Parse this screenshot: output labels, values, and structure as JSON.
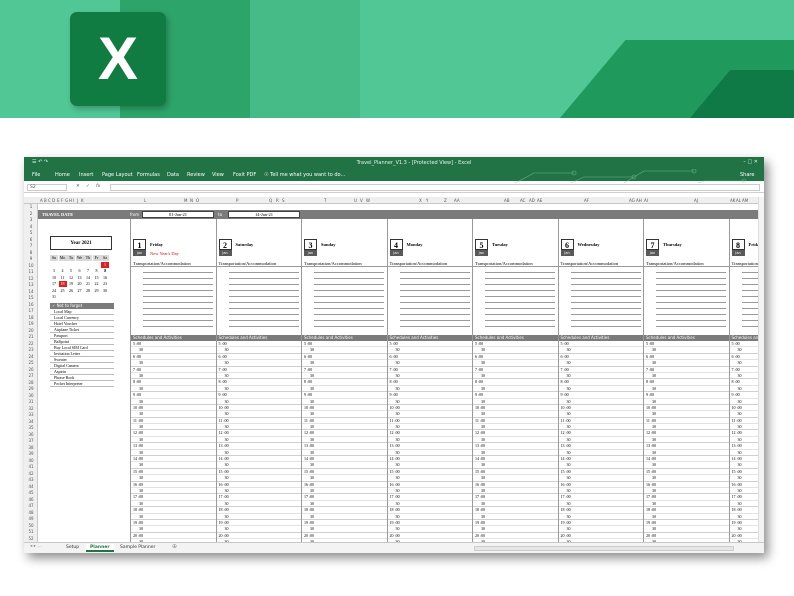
{
  "banner": {
    "logo_letter": "X"
  },
  "window": {
    "title": "Travel_Planner_V1.3 - [Protected View] - Excel",
    "quick_access": "☰  ↶  ↷",
    "window_controls": "–  □  ✕",
    "menu": [
      "File",
      "Home",
      "Insert",
      "Page Layout",
      "Formulas",
      "Data",
      "Review",
      "View",
      "Foxit PDF"
    ],
    "tell_me": "☉  Tell me what you want to do...",
    "share": "Share"
  },
  "formula_bar": {
    "name_box": "S2",
    "fx": "fx",
    "value": ""
  },
  "columns": [
    "A",
    "B",
    "C",
    "D",
    "E",
    "F",
    "G",
    "H",
    "I",
    "J",
    "K",
    "L",
    "M",
    "N",
    "O",
    "P",
    "Q",
    "R",
    "S",
    "T",
    "U",
    "V",
    "W",
    "X",
    "Y",
    "Z",
    "AA",
    "AB",
    "AC",
    "AD",
    "AE",
    "AF",
    "AG",
    "AH",
    "AI",
    "AJ",
    "AK",
    "AL",
    "AM",
    "AN"
  ],
  "rows": [
    "1",
    "2",
    "3",
    "4",
    "5",
    "6",
    "7",
    "8",
    "9",
    "10",
    "11",
    "12",
    "13",
    "14",
    "15",
    "16",
    "17",
    "18",
    "19",
    "20",
    "21",
    "22",
    "23",
    "24",
    "25",
    "26",
    "27",
    "28",
    "29",
    "30",
    "31",
    "32",
    "33",
    "34",
    "35",
    "36",
    "37",
    "38",
    "39",
    "40",
    "41",
    "42",
    "43",
    "44",
    "45",
    "46",
    "47",
    "48",
    "49",
    "50",
    "51",
    "52"
  ],
  "travel": {
    "label": "TRAVEL DATE",
    "from_label": "from",
    "from": "01-Jan-21",
    "to_label": "to",
    "to": "14-Jan-21"
  },
  "calendar": {
    "year": "Year 2021",
    "weekdays": [
      "Su",
      "Mo",
      "Tu",
      "We",
      "Th",
      "Fr",
      "Sa"
    ],
    "days": [
      [
        "",
        "",
        "",
        "",
        "",
        "",
        "1"
      ],
      [
        "3",
        "4",
        "5",
        "6",
        "7",
        "8",
        "9"
      ],
      [
        "10",
        "11",
        "12",
        "13",
        "14",
        "15",
        "16"
      ],
      [
        "17",
        "18",
        "19",
        "20",
        "21",
        "22",
        "23"
      ],
      [
        "24",
        "25",
        "26",
        "27",
        "28",
        "29",
        "30"
      ],
      [
        "31",
        "",
        "",
        "",
        "",
        "",
        ""
      ]
    ],
    "extra": "2"
  },
  "todo": {
    "header": "✓  Not to forget",
    "items": [
      "Local Map",
      "Local Currency",
      "Hotel Voucher",
      "Airplane Ticket",
      "Passport",
      "Ballpoint",
      "Buy Local SIM Card",
      "Invitation Letter",
      "Sweater",
      "Digital Camera",
      "Aspirin",
      "Phrase Book",
      "Pocket Interpreter"
    ]
  },
  "days": [
    {
      "num": "1",
      "month": "Jan",
      "name": "Friday",
      "holiday": "New Year's Day"
    },
    {
      "num": "2",
      "month": "Jan",
      "name": "Saturday",
      "holiday": ""
    },
    {
      "num": "3",
      "month": "Jan",
      "name": "Sunday",
      "holiday": ""
    },
    {
      "num": "4",
      "month": "Jan",
      "name": "Monday",
      "holiday": ""
    },
    {
      "num": "5",
      "month": "Jan",
      "name": "Tuesday",
      "holiday": ""
    },
    {
      "num": "6",
      "month": "Jan",
      "name": "Wednesday",
      "holiday": ""
    },
    {
      "num": "7",
      "month": "Jan",
      "name": "Thursday",
      "holiday": ""
    },
    {
      "num": "8",
      "month": "Jan",
      "name": "Friday",
      "holiday": ""
    }
  ],
  "transport_label": "Transportation/Accommodation",
  "schedule_label": "Schedules and Activities",
  "slots": [
    "5 :00",
    "30",
    "6 :00",
    "30",
    "7 :00",
    "30",
    "8 :00",
    "30",
    "9 :00",
    "30",
    "10 :00",
    "30",
    "11 :00",
    "30",
    "12 :00",
    "30",
    "13 :00",
    "30",
    "14 :00",
    "30",
    "15 :00",
    "30",
    "16 :00",
    "30",
    "17 :00",
    "30",
    "18 :00",
    "30",
    "19 :00",
    "30",
    "20 :00",
    "30",
    "21 :00",
    "30"
  ],
  "sheet_tabs": [
    "Setup",
    "Planner",
    "Sample Planner"
  ],
  "active_tab": "Planner",
  "tab_nav": "◂  ▸  ...",
  "add_sheet": "⊕"
}
